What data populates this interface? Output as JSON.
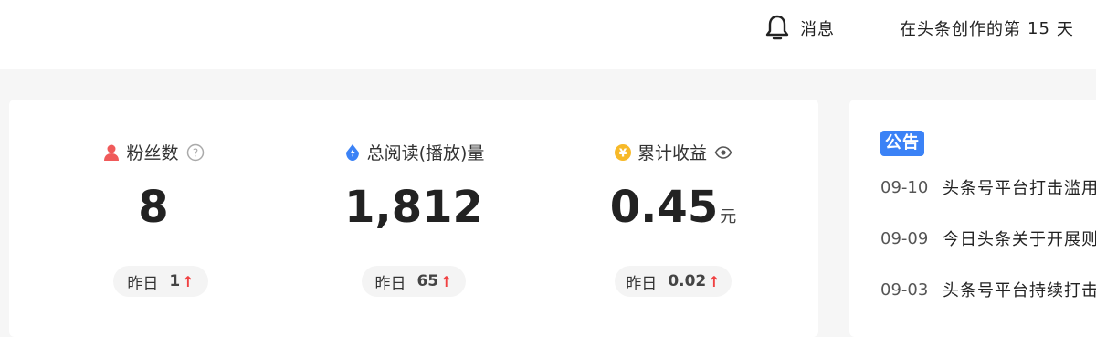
{
  "header": {
    "notifications_label": "消息",
    "days_prefix": "在头条创作的第",
    "days_count": "15",
    "days_suffix": "天"
  },
  "stats": [
    {
      "title": "粉丝数",
      "icon": "user-icon",
      "value": "8",
      "unit": "",
      "yesterday_label": "昨日",
      "yesterday_value": "1",
      "trend": "up"
    },
    {
      "title": "总阅读(播放)量",
      "icon": "read-drop-icon",
      "value": "1,812",
      "unit": "",
      "yesterday_label": "昨日",
      "yesterday_value": "65",
      "trend": "up"
    },
    {
      "title": "累计收益",
      "icon": "yuan-coin-icon",
      "value": "0.45",
      "unit": "元",
      "yesterday_label": "昨日",
      "yesterday_value": "0.02",
      "trend": "up"
    }
  ],
  "announcements": {
    "tag": "公告",
    "items": [
      {
        "date": "09-10",
        "text": "头条号平台打击滥用"
      },
      {
        "date": "09-09",
        "text": "今日头条关于开展则"
      },
      {
        "date": "09-03",
        "text": "头条号平台持续打击"
      }
    ]
  },
  "colors": {
    "accent_blue": "#3b82f6",
    "up_red": "#f04142",
    "coin_yellow": "#f7b928",
    "user_red": "#f05a5a"
  }
}
